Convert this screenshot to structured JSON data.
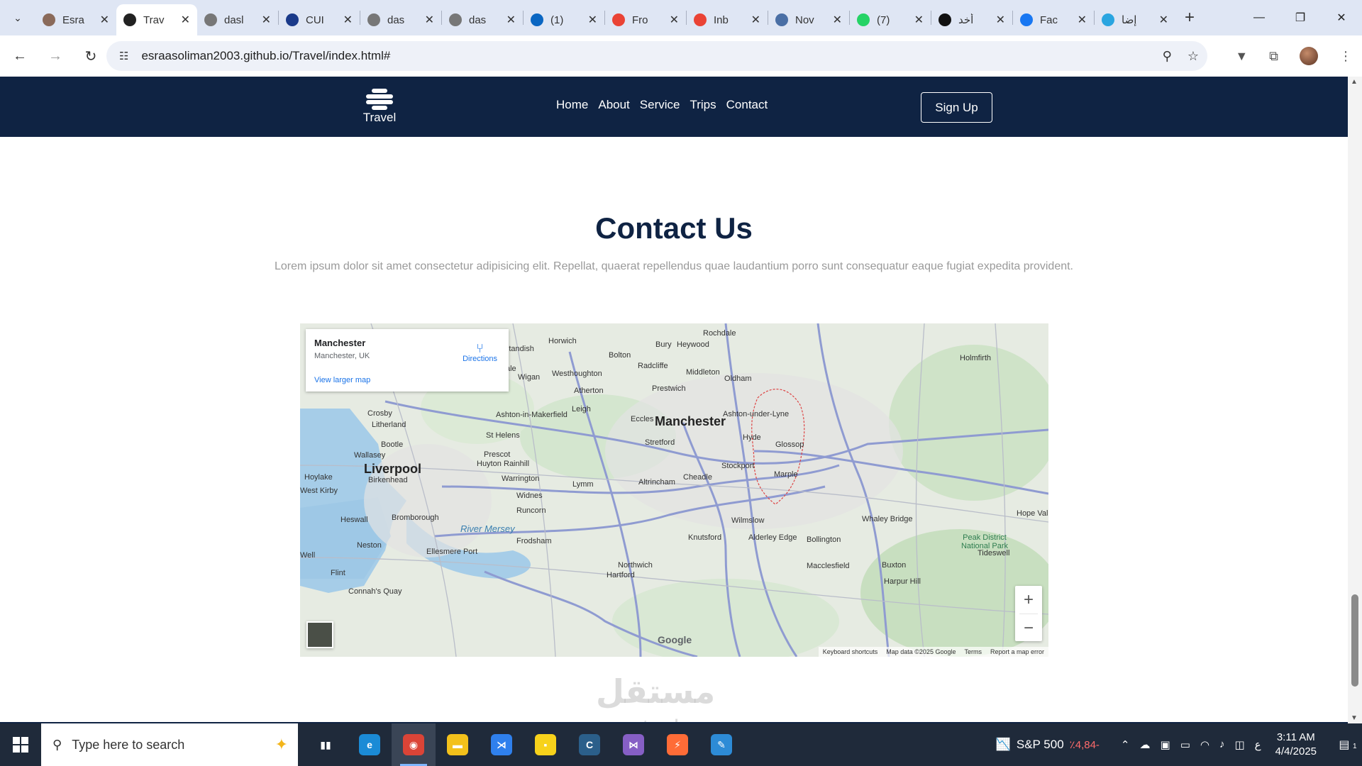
{
  "browser": {
    "tabs": [
      {
        "title": "Esra",
        "favicon_color": "#8a6a5a",
        "favicon": "person-icon"
      },
      {
        "title": "Trav",
        "favicon_color": "#222222",
        "favicon": "camera-icon",
        "active": true
      },
      {
        "title": "dasl",
        "favicon_color": "#777777",
        "favicon": "globe-icon"
      },
      {
        "title": "CUI",
        "favicon_color": "#1a3a8a",
        "favicon": "globe-icon"
      },
      {
        "title": "das",
        "favicon_color": "#777777",
        "favicon": "globe-icon"
      },
      {
        "title": "das",
        "favicon_color": "#777777",
        "favicon": "globe-icon"
      },
      {
        "title": "(1)",
        "favicon_color": "#0a66c2",
        "favicon": "linkedin-icon"
      },
      {
        "title": "Fro",
        "favicon_color": "#ea4335",
        "favicon": "gmail-icon"
      },
      {
        "title": "Inb",
        "favicon_color": "#ea4335",
        "favicon": "gmail-icon"
      },
      {
        "title": "Nov",
        "favicon_color": "#4a6fa5",
        "favicon": "chart-icon"
      },
      {
        "title": "(7)",
        "favicon_color": "#25d366",
        "favicon": "whatsapp-icon"
      },
      {
        "title": "أخد",
        "favicon_color": "#111111",
        "favicon": "openai-icon"
      },
      {
        "title": "Fac",
        "favicon_color": "#1877f2",
        "favicon": "facebook-icon"
      },
      {
        "title": "إضا",
        "favicon_color": "#2aa5e0",
        "favicon": "circle-icon"
      }
    ],
    "url": "esraasoliman2003.github.io/Travel/index.html#"
  },
  "site": {
    "logo_text": "Travel",
    "menu": [
      "Home",
      "About",
      "Service",
      "Trips",
      "Contact"
    ],
    "signup": "Sign Up",
    "contact_title": "Contact Us",
    "contact_desc": "Lorem ipsum dolor sit amet consectetur adipisicing elit. Repellat, quaerat repellendus quae laudantium porro sunt consequatur eaque fugiat expedita provident."
  },
  "map": {
    "card": {
      "name": "Manchester",
      "address": "Manchester, UK",
      "directions": "Directions",
      "larger": "View larger map"
    },
    "places": [
      {
        "name": "Manchester",
        "size": "big"
      },
      {
        "name": "Liverpool",
        "size": "big"
      },
      {
        "name": "Rochdale"
      },
      {
        "name": "Bolton"
      },
      {
        "name": "Bury"
      },
      {
        "name": "Heywood"
      },
      {
        "name": "Horwich"
      },
      {
        "name": "Standish"
      },
      {
        "name": "Radcliffe"
      },
      {
        "name": "Middleton"
      },
      {
        "name": "Oldham"
      },
      {
        "name": "Prestwich"
      },
      {
        "name": "Westhoughton"
      },
      {
        "name": "Wigan"
      },
      {
        "name": "Atherton"
      },
      {
        "name": "Leigh"
      },
      {
        "name": "Ashton-in-Makerfield"
      },
      {
        "name": "Eccles"
      },
      {
        "name": "Ashton-under-Lyne"
      },
      {
        "name": "Hyde"
      },
      {
        "name": "Stretford"
      },
      {
        "name": "Glossop"
      },
      {
        "name": "Stockport"
      },
      {
        "name": "Cheadle"
      },
      {
        "name": "Marple"
      },
      {
        "name": "Altrincham"
      },
      {
        "name": "Warrington"
      },
      {
        "name": "Lymm"
      },
      {
        "name": "St Helens"
      },
      {
        "name": "Prescot"
      },
      {
        "name": "Huyton"
      },
      {
        "name": "Rainhill"
      },
      {
        "name": "Crosby"
      },
      {
        "name": "Litherland"
      },
      {
        "name": "Bootle"
      },
      {
        "name": "Wallasey"
      },
      {
        "name": "Birkenhead"
      },
      {
        "name": "Hoylake"
      },
      {
        "name": "West Kirby"
      },
      {
        "name": "Heswall"
      },
      {
        "name": "Bromborough"
      },
      {
        "name": "Widnes"
      },
      {
        "name": "Runcorn"
      },
      {
        "name": "Frodsham"
      },
      {
        "name": "Neston"
      },
      {
        "name": "Ellesmere Port"
      },
      {
        "name": "Flint"
      },
      {
        "name": "Connah's Quay"
      },
      {
        "name": "Northwich"
      },
      {
        "name": "Hartford"
      },
      {
        "name": "Knutsford"
      },
      {
        "name": "Alderley Edge"
      },
      {
        "name": "Wilmslow"
      },
      {
        "name": "Bollington"
      },
      {
        "name": "Macclesfield"
      },
      {
        "name": "Whaley Bridge"
      },
      {
        "name": "Buxton"
      },
      {
        "name": "Harpur Hill"
      },
      {
        "name": "Holmfirth"
      },
      {
        "name": "Hope Val"
      },
      {
        "name": "Skelmersdale"
      },
      {
        "name": "Well"
      },
      {
        "name": "Tideswell"
      },
      {
        "name": "Peak District National Park"
      },
      {
        "name": "River Mersey"
      }
    ],
    "google_label": "Google",
    "attribution": [
      "Keyboard shortcuts",
      "Map data ©2025 Google",
      "Terms",
      "Report a map error"
    ]
  },
  "watermark": {
    "arabic": "مستقل",
    "latin": "mostaql.com"
  },
  "taskbar": {
    "search_placeholder": "Type here to search",
    "apps": [
      {
        "name": "task-view-icon",
        "color": "#1f2a3a",
        "glyph": "▮▮"
      },
      {
        "name": "edge-icon",
        "color": "#1b8bd6",
        "glyph": "e"
      },
      {
        "name": "chrome-icon",
        "color": "#db4437",
        "glyph": "◉",
        "active": true
      },
      {
        "name": "file-explorer-icon",
        "color": "#f3c11b",
        "glyph": "▬"
      },
      {
        "name": "vscode-icon",
        "color": "#2f80ed",
        "glyph": "⋊"
      },
      {
        "name": "sticky-notes-icon",
        "color": "#f7d21b",
        "glyph": "▪"
      },
      {
        "name": "edge-dev-icon",
        "color": "#2b5f8a",
        "glyph": "C"
      },
      {
        "name": "visual-studio-icon",
        "color": "#865fc5",
        "glyph": "⋈"
      },
      {
        "name": "postman-icon",
        "color": "#ff6c37",
        "glyph": "⚡"
      },
      {
        "name": "azure-data-studio-icon",
        "color": "#2d8bd6",
        "glyph": "✎"
      }
    ],
    "stock_name": "S&P 500",
    "stock_change": "٪4,84-",
    "ime": "ع",
    "time": "3:11 AM",
    "date": "4/4/2025",
    "notifications": "1"
  }
}
